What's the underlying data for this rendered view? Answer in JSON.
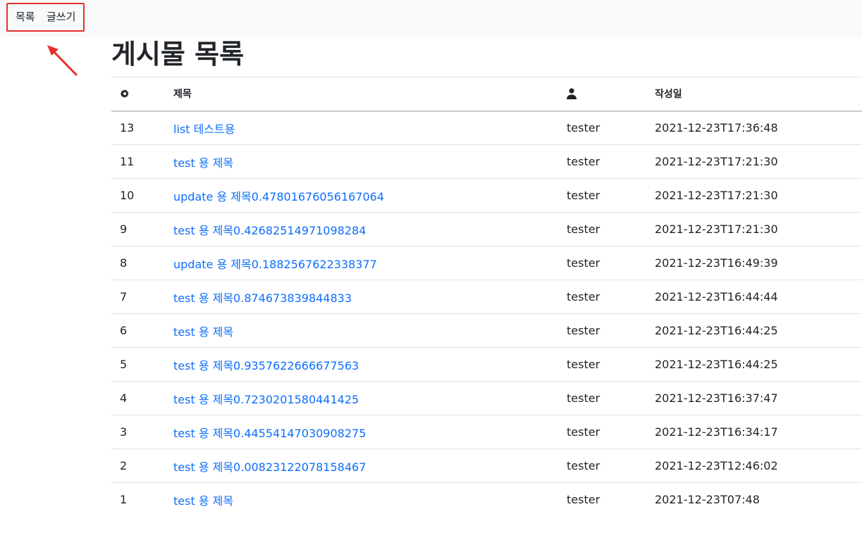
{
  "nav": {
    "list_label": "목록",
    "write_label": "글쓰기"
  },
  "page": {
    "title": "게시물 목록"
  },
  "table": {
    "headers": {
      "no_icon": "gear-icon",
      "title": "제목",
      "writer_icon": "person-icon",
      "date": "작성일"
    },
    "rows": [
      {
        "no": "13",
        "title": "list 테스트용",
        "writer": "tester",
        "date": "2021-12-23T17:36:48"
      },
      {
        "no": "11",
        "title": "test 용 제목",
        "writer": "tester",
        "date": "2021-12-23T17:21:30"
      },
      {
        "no": "10",
        "title": "update 용 제목0.47801676056167064",
        "writer": "tester",
        "date": "2021-12-23T17:21:30"
      },
      {
        "no": "9",
        "title": "test 용 제목0.42682514971098284",
        "writer": "tester",
        "date": "2021-12-23T17:21:30"
      },
      {
        "no": "8",
        "title": "update 용 제목0.1882567622338377",
        "writer": "tester",
        "date": "2021-12-23T16:49:39"
      },
      {
        "no": "7",
        "title": "test 용 제목0.874673839844833",
        "writer": "tester",
        "date": "2021-12-23T16:44:44"
      },
      {
        "no": "6",
        "title": "test 용 제목",
        "writer": "tester",
        "date": "2021-12-23T16:44:25"
      },
      {
        "no": "5",
        "title": "test 용 제목0.9357622666677563",
        "writer": "tester",
        "date": "2021-12-23T16:44:25"
      },
      {
        "no": "4",
        "title": "test 용 제목0.7230201580441425",
        "writer": "tester",
        "date": "2021-12-23T16:37:47"
      },
      {
        "no": "3",
        "title": "test 용 제목0.44554147030908275",
        "writer": "tester",
        "date": "2021-12-23T16:34:17"
      },
      {
        "no": "2",
        "title": "test 용 제목0.00823122078158467",
        "writer": "tester",
        "date": "2021-12-23T12:46:02"
      },
      {
        "no": "1",
        "title": "test 용 제목",
        "writer": "tester",
        "date": "2021-12-23T07:48"
      }
    ]
  },
  "colors": {
    "link": "#0d6efd",
    "highlight": "#e8302c",
    "topbar_bg": "#f8f9fa"
  }
}
